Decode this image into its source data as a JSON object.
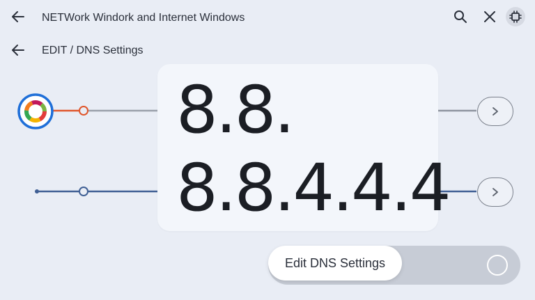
{
  "header": {
    "title": "NETWork Windork and Internet Windows"
  },
  "breadcrumb": {
    "label": "EDIT / DNS Settings"
  },
  "dns": {
    "line1": "8.8.",
    "line2": "8.8.4.4.4"
  },
  "toggle": {
    "label": "Edit DNS Settings"
  },
  "colors": {
    "background": "#e9edf5",
    "orange_line": "#e0562b",
    "blue_line": "#3f5f94",
    "ring_blue": "#1f6fd8"
  },
  "icons": {
    "back": "arrow-left-icon",
    "search": "search-icon",
    "close": "close-icon",
    "settings": "chip-icon",
    "chevron": "chevron-right-icon"
  }
}
